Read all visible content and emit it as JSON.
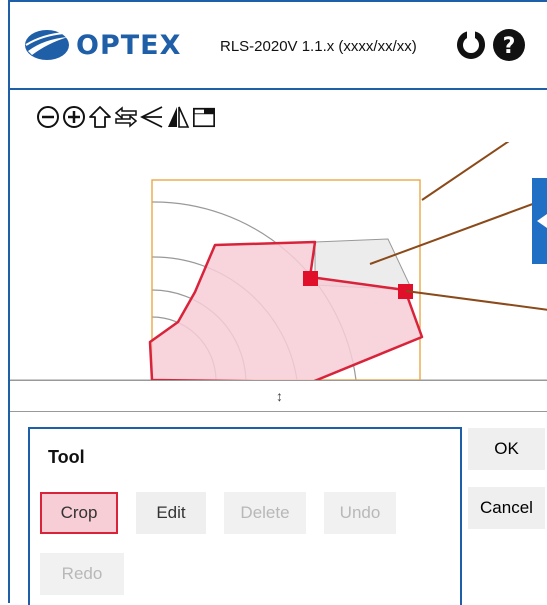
{
  "header": {
    "brand": "OPTEX",
    "version": "RLS-2020V 1.1.x (xxxx/xx/xx)",
    "icons": [
      "logo-swoosh-icon",
      "rotate-icon",
      "help-icon"
    ]
  },
  "toolbar": {
    "icons": [
      "zoom-out-icon",
      "zoom-in-icon",
      "home-icon",
      "swap-icon",
      "fan-icon",
      "mirror-icon",
      "window-icon"
    ]
  },
  "splitter": {
    "glyph": "↕"
  },
  "tool_panel": {
    "title": "Tool",
    "buttons": [
      {
        "label": "Crop",
        "state": "active"
      },
      {
        "label": "Edit",
        "state": "normal"
      },
      {
        "label": "Delete",
        "state": "disabled"
      },
      {
        "label": "Undo",
        "state": "disabled"
      },
      {
        "label": "Redo",
        "state": "disabled"
      }
    ]
  },
  "side_buttons": {
    "ok": "OK",
    "cancel": "Cancel"
  },
  "colors": {
    "accent": "#1f5fa8",
    "crop_fill": "#f7cdd6",
    "crop_stroke": "#d8233a",
    "area_border": "#e8a23a",
    "callout_line": "#8a4a1a"
  }
}
